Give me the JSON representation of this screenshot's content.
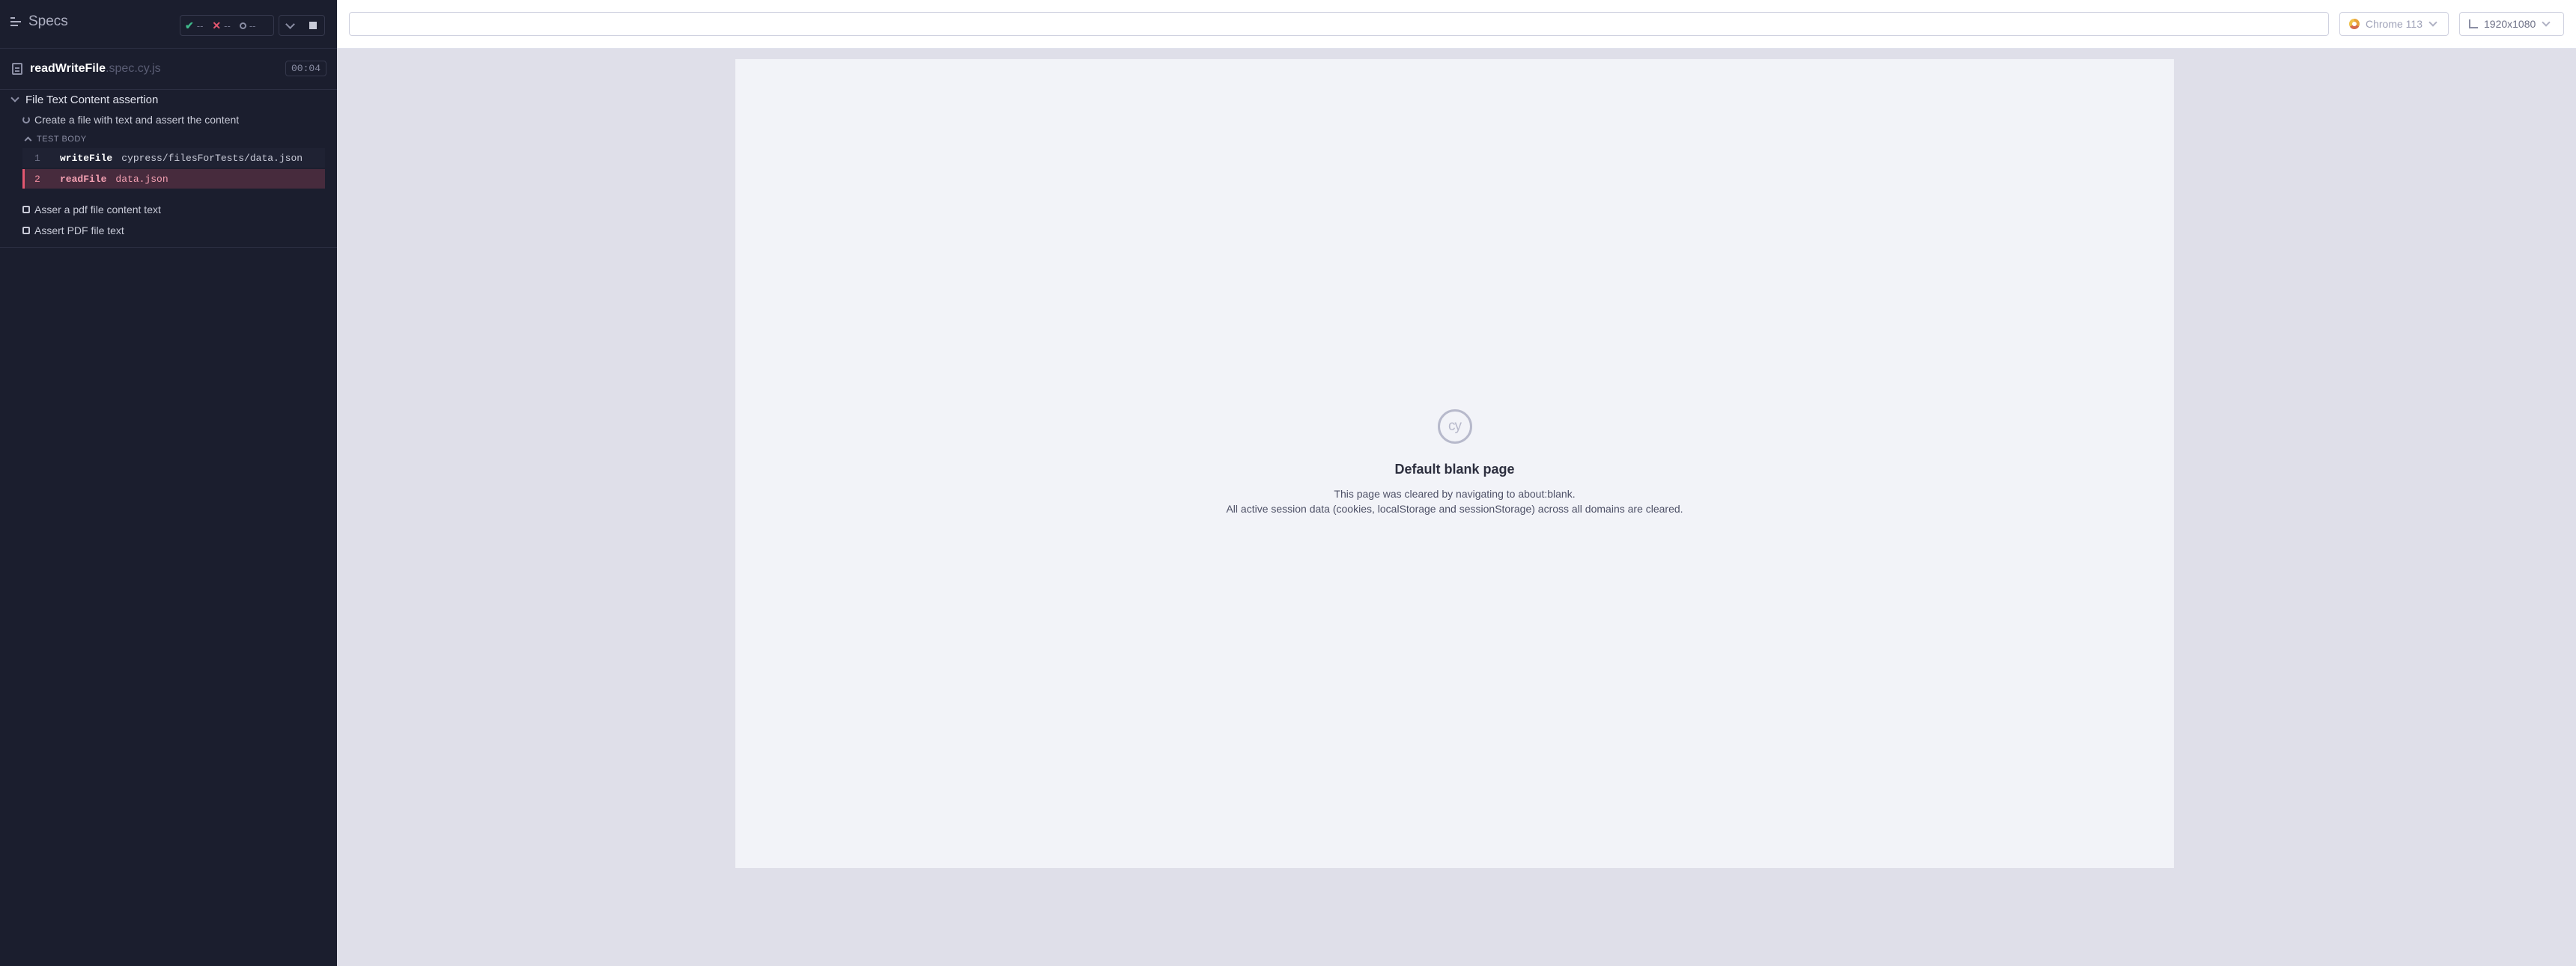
{
  "reporter": {
    "header": {
      "specs_label": "Specs",
      "stats": {
        "passed": "--",
        "failed": "--",
        "pending": "--"
      }
    },
    "spec": {
      "name": "readWriteFile",
      "ext": ".spec.cy.js",
      "duration": "00:04"
    },
    "suite": {
      "title": "File Text Content assertion",
      "running_test": "Create a file with text and assert the content",
      "body_label": "TEST BODY",
      "commands": [
        {
          "num": "1",
          "name": "writeFile",
          "arg": "cypress/filesForTests/data.json"
        },
        {
          "num": "2",
          "name": "readFile",
          "arg": "data.json"
        }
      ],
      "other_tests": [
        "Asser a pdf file content text",
        "Assert PDF file text"
      ]
    }
  },
  "topbar": {
    "url_value": "",
    "browser": "Chrome 113",
    "viewport": "1920x1080"
  },
  "aut": {
    "logo_text": "cy",
    "title": "Default blank page",
    "line1": "This page was cleared by navigating to about:blank.",
    "line2": "All active session data (cookies, localStorage and sessionStorage) across all domains are cleared."
  },
  "colors": {
    "reporter_bg": "#1b1e2e",
    "fail": "#e45770",
    "pass": "#3fb88a"
  }
}
